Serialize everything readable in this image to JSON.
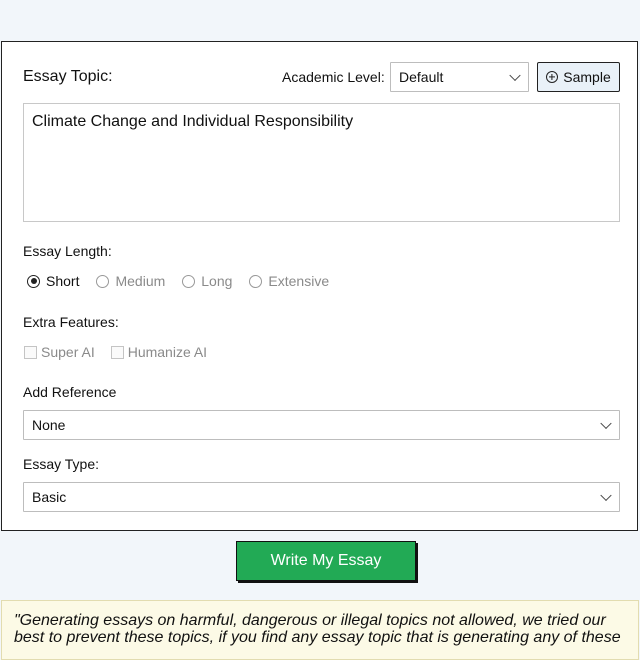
{
  "form": {
    "topic_label": "Essay Topic:",
    "academic_label": "Academic Level:",
    "academic_value": "Default",
    "sample_label": "Sample",
    "topic_value": "Climate Change and Individual Responsibility",
    "length_label": "Essay Length:",
    "length_options": [
      {
        "label": "Short",
        "checked": true
      },
      {
        "label": "Medium",
        "checked": false
      },
      {
        "label": "Long",
        "checked": false
      },
      {
        "label": "Extensive",
        "checked": false
      }
    ],
    "features_label": "Extra Features:",
    "features": [
      {
        "label": "Super AI"
      },
      {
        "label": "Humanize AI"
      }
    ],
    "reference_label": "Add Reference",
    "reference_value": "None",
    "type_label": "Essay Type:",
    "type_value": "Basic"
  },
  "actions": {
    "write_label": "Write My Essay"
  },
  "notice": {
    "text": "\"Generating essays on harmful, dangerous or illegal topics not allowed, we tried our best to prevent these topics, if you find any essay topic that is generating any of these"
  },
  "colors": {
    "accent": "#22aa55",
    "background": "#f2f6fa",
    "notice_bg": "#fcfae6"
  }
}
